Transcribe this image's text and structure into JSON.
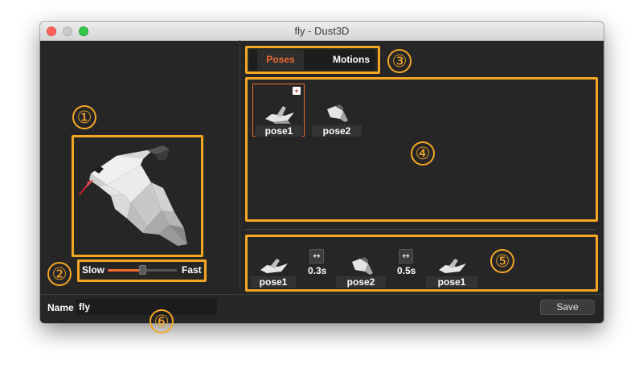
{
  "window": {
    "title": "fly - Dust3D"
  },
  "markers": {
    "m1": "①",
    "m2": "②",
    "m3": "③",
    "m4": "④",
    "m5": "⑤",
    "m6": "⑥"
  },
  "speed": {
    "slow_label": "Slow",
    "fast_label": "Fast",
    "value": 0.52
  },
  "tabs": [
    {
      "label": "Poses",
      "active": true,
      "color": "#f06a2d"
    },
    {
      "label": "Motions",
      "active": false,
      "color": "#ffffff"
    }
  ],
  "poses": [
    {
      "label": "pose1",
      "selected": true,
      "icon": "bird-wings-up-icon"
    },
    {
      "label": "pose2",
      "selected": false,
      "icon": "bird-wings-folded-icon"
    }
  ],
  "timeline": {
    "clips": [
      {
        "label": "pose1",
        "icon": "bird-wings-up-icon"
      },
      {
        "label": "pose2",
        "icon": "bird-wings-folded-icon"
      },
      {
        "label": "pose1",
        "icon": "bird-wings-up-icon"
      }
    ],
    "intervals": [
      {
        "duration": "0.3s",
        "icon": "resize-horizontal-icon"
      },
      {
        "duration": "0.5s",
        "icon": "resize-horizontal-icon"
      }
    ]
  },
  "footer": {
    "name_label": "Name",
    "name_value": "fly",
    "save_label": "Save"
  },
  "colors": {
    "highlight": "#f5a623",
    "active_tab": "#f06a2d",
    "window_bg": "#262626"
  }
}
